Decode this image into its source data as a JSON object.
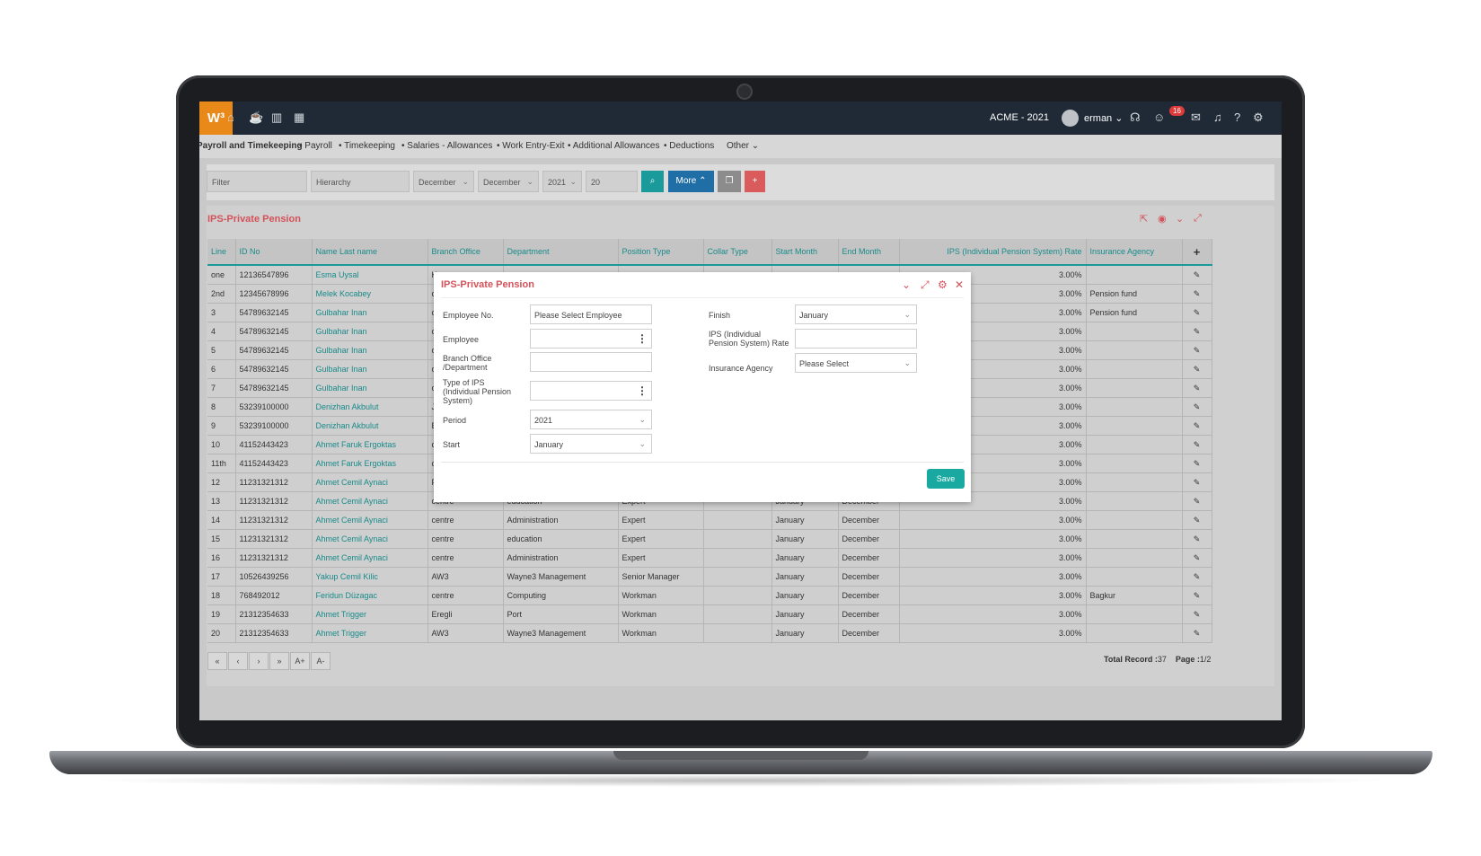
{
  "topbar": {
    "logo": "W³",
    "company": "ACME - 2021",
    "user": "erman ⌄",
    "badge_count": "16"
  },
  "menu": {
    "items": [
      "Payroll and Timekeeping",
      "• Payroll",
      "• Timekeeping",
      "• Salaries - Allowances",
      "• Work Entry-Exit",
      "• Additional Allowances",
      "• Deductions",
      "Other ⌄"
    ]
  },
  "filters": {
    "filter": "Filter",
    "hierarchy": "Hierarchy",
    "month1": "December",
    "month2": "December",
    "year": "2021",
    "count": "20",
    "more_label": "More ⌃"
  },
  "panel": {
    "title": "IPS-Private Pension"
  },
  "table": {
    "headers": [
      "Line",
      "ID No",
      "Name Last name",
      "Branch Office",
      "Department",
      "Position Type",
      "Collar Type",
      "Start Month",
      "End Month",
      "IPS (Individual Pension System) Rate",
      "Insurance Agency",
      "+"
    ],
    "rows": [
      [
        "one",
        "12136547896",
        "Esma Uysal",
        "Ka",
        "",
        "",
        "",
        "",
        "",
        "3.00%",
        ""
      ],
      [
        "2nd",
        "12345678996",
        "Melek Kocabey",
        "ce",
        "",
        "",
        "",
        "",
        "",
        "3.00%",
        "Pension fund"
      ],
      [
        "3",
        "54789632145",
        "Gulbahar Inan",
        "ce",
        "",
        "",
        "",
        "",
        "",
        "3.00%",
        "Pension fund"
      ],
      [
        "4",
        "54789632145",
        "Gulbahar Inan",
        "ce",
        "",
        "",
        "",
        "",
        "",
        "3.00%",
        ""
      ],
      [
        "5",
        "54789632145",
        "Gulbahar Inan",
        "ce",
        "",
        "",
        "",
        "",
        "",
        "3.00%",
        ""
      ],
      [
        "6",
        "54789632145",
        "Gulbahar Inan",
        "ce",
        "",
        "",
        "",
        "",
        "",
        "3.00%",
        ""
      ],
      [
        "7",
        "54789632145",
        "Gulbahar Inan",
        "ce",
        "",
        "",
        "",
        "",
        "",
        "3.00%",
        ""
      ],
      [
        "8",
        "53239100000",
        "Denizhan Akbulut",
        "Je",
        "",
        "",
        "",
        "",
        "",
        "3.00%",
        ""
      ],
      [
        "9",
        "53239100000",
        "Denizhan Akbulut",
        "Ba",
        "",
        "",
        "",
        "",
        "",
        "3.00%",
        ""
      ],
      [
        "10",
        "41152443423",
        "Ahmet Faruk Ergoktas",
        "ce",
        "",
        "",
        "",
        "",
        "",
        "3.00%",
        ""
      ],
      [
        "11th",
        "41152443423",
        "Ahmet Faruk Ergoktas",
        "ce",
        "",
        "",
        "",
        "",
        "",
        "3.00%",
        ""
      ],
      [
        "12",
        "11231321312",
        "Ahmet Cemil Aynaci",
        "Fa",
        "",
        "",
        "",
        "",
        "",
        "3.00%",
        ""
      ],
      [
        "13",
        "11231321312",
        "Ahmet Cemil Aynaci",
        "centre",
        "education",
        "Expert",
        "",
        "January",
        "December",
        "3.00%",
        ""
      ],
      [
        "14",
        "11231321312",
        "Ahmet Cemil Aynaci",
        "centre",
        "Administration",
        "Expert",
        "",
        "January",
        "December",
        "3.00%",
        ""
      ],
      [
        "15",
        "11231321312",
        "Ahmet Cemil Aynaci",
        "centre",
        "education",
        "Expert",
        "",
        "January",
        "December",
        "3.00%",
        ""
      ],
      [
        "16",
        "11231321312",
        "Ahmet Cemil Aynaci",
        "centre",
        "Administration",
        "Expert",
        "",
        "January",
        "December",
        "3.00%",
        ""
      ],
      [
        "17",
        "10526439256",
        "Yakup Cemil Kilic",
        "AW3",
        "Wayne3 Management",
        "Senior Manager",
        "",
        "January",
        "December",
        "3.00%",
        ""
      ],
      [
        "18",
        "768492012",
        "Feridun Düzagac",
        "centre",
        "Computing",
        "Workman",
        "",
        "January",
        "December",
        "3.00%",
        "Bagkur"
      ],
      [
        "19",
        "21312354633",
        "Ahmet Trigger",
        "Eregli",
        "Port",
        "Workman",
        "",
        "January",
        "December",
        "3.00%",
        ""
      ],
      [
        "20",
        "21312354633",
        "Ahmet Trigger",
        "AW3",
        "Wayne3 Management",
        "Workman",
        "",
        "January",
        "December",
        "3.00%",
        ""
      ]
    ]
  },
  "pager": {
    "buttons": [
      "«",
      "‹",
      "›",
      "»",
      "A+",
      "A-"
    ],
    "total_label": "Total Record :",
    "total_value": "37",
    "page_label": "Page :",
    "page_value": "1/2"
  },
  "modal": {
    "title": "IPS-Private Pension",
    "employee_no_label": "Employee No.",
    "employee_no_value": "Please Select Employee",
    "employee_label": "Employee",
    "branch_label_1": "Branch Office",
    "branch_label_2": "/Department",
    "type_label_1": "Type of IPS",
    "type_label_2": "(Individual Pension",
    "type_label_3": "System)",
    "period_label": "Period",
    "period_value": "2021",
    "start_label": "Start",
    "start_value": "January",
    "finish_label": "Finish",
    "finish_value": "January",
    "rate_label_1": "IPS (Individual",
    "rate_label_2": "Pension System) Rate",
    "agency_label": "Insurance Agency",
    "agency_value": "Please Select",
    "save_label": "Save"
  },
  "colors": {
    "accent": "#1a9a9a",
    "brand": "#e8891a",
    "title": "#d4525a",
    "topbar": "#1f2a36"
  }
}
